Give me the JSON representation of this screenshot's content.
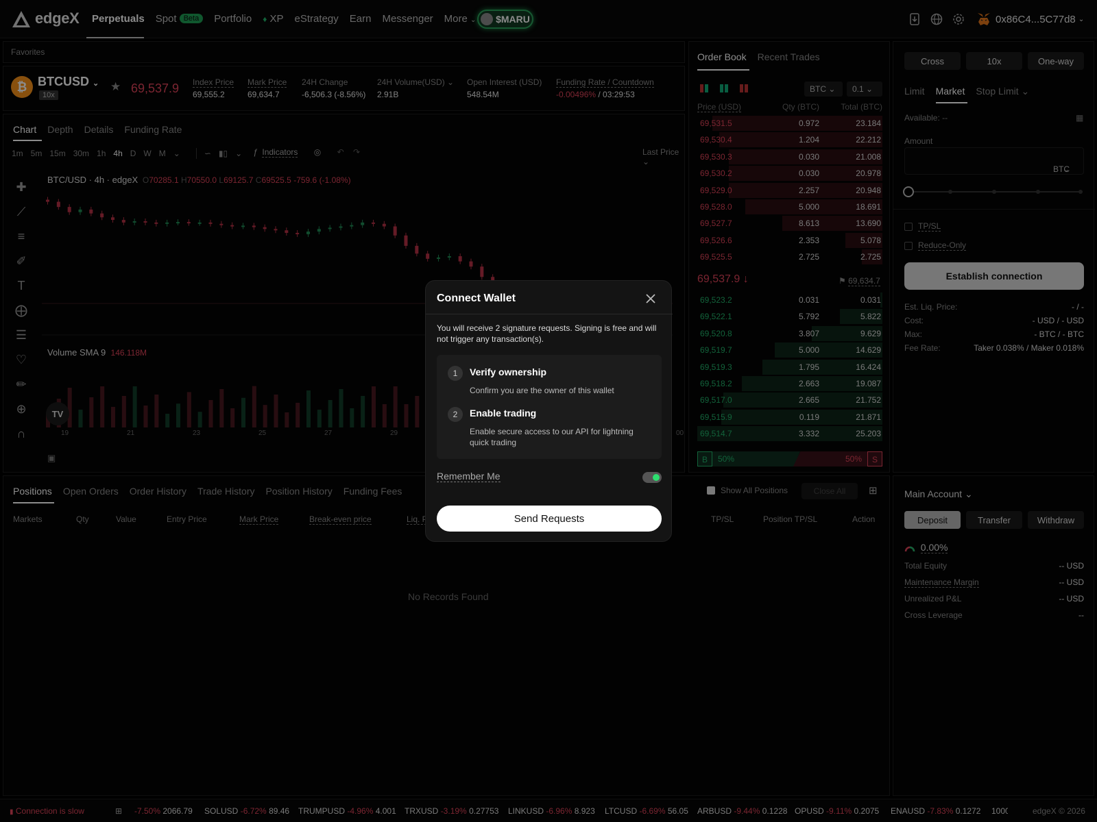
{
  "header": {
    "logo_text": "edgeX",
    "nav": [
      {
        "label": "Perpetuals",
        "active": true
      },
      {
        "label": "Spot",
        "badge": "Beta"
      },
      {
        "label": "Portfolio"
      },
      {
        "label": "XP"
      },
      {
        "label": "eStrategy"
      },
      {
        "label": "Earn"
      },
      {
        "label": "Messenger"
      },
      {
        "label": "More"
      }
    ],
    "promo": "$MARU",
    "account": "0x86C4...5C77d8"
  },
  "favorites_label": "Favorites",
  "ticker": {
    "symbol": "BTCUSD",
    "leverage": "10x",
    "last_price": "69,537.9",
    "stats": [
      {
        "label": "Index Price",
        "value": "69,555.2"
      },
      {
        "label": "Mark Price",
        "value": "69,634.7"
      },
      {
        "label": "24H Change",
        "value": "-6,506.3 (-8.56%)"
      },
      {
        "label": "24H Volume(USD)",
        "value": "2.91B"
      },
      {
        "label": "Open Interest (USD)",
        "value": "548.54M"
      },
      {
        "label": "Funding Rate / Countdown",
        "value": "-0.00496%",
        "value2": "/ 03:29:53"
      }
    ]
  },
  "chart": {
    "tabs": [
      "Chart",
      "Depth",
      "Details",
      "Funding Rate"
    ],
    "timeframes": [
      "1m",
      "5m",
      "15m",
      "30m",
      "1h",
      "4h",
      "D",
      "W",
      "M"
    ],
    "indicators_label": "Indicators",
    "last_price_label": "Last Price",
    "legend_title": "BTC/USD · 4h · edgeX",
    "ohlc": {
      "o": "70285.1",
      "h": "70550.0",
      "l": "69125.7",
      "c": "69525.5",
      "chg": "-759.6 (-1.08%)"
    },
    "volume_label": "Volume SMA 9",
    "volume_value": "146.118M",
    "x_labels": [
      "19",
      "21",
      "23",
      "25",
      "27",
      "29",
      "00"
    ],
    "logo": "TV"
  },
  "chart_data": {
    "type": "candlestick",
    "title": "BTC/USD · 4h · edgeX",
    "x_labels": [
      "19",
      "21",
      "23",
      "25",
      "27",
      "29"
    ],
    "close": [
      70100,
      69900,
      69700,
      69800,
      69650,
      69500,
      69400,
      69300,
      69350,
      69300,
      69250,
      69300,
      69320,
      69280,
      69300,
      69250,
      69200,
      69150,
      69180,
      69120,
      69050,
      69000,
      68900,
      68850,
      68950,
      69050,
      69100,
      69150,
      69200,
      69300,
      69250,
      69150,
      68800,
      68400,
      68100,
      67900,
      67950,
      68000,
      67800,
      67600,
      67200,
      66900,
      66800,
      66850,
      66900,
      66950,
      66900,
      66850
    ]
  },
  "order_book": {
    "tabs": [
      "Order Book",
      "Recent Trades"
    ],
    "unit": "BTC",
    "step": "0.1",
    "columns": [
      "Price (USD)",
      "Qty (BTC)",
      "Total (BTC)"
    ],
    "asks": [
      {
        "price": "69,531.5",
        "qty": "0.972",
        "total": "23.184",
        "depth": 0.92
      },
      {
        "price": "69,530.4",
        "qty": "1.204",
        "total": "22.212",
        "depth": 0.88
      },
      {
        "price": "69,530.3",
        "qty": "0.030",
        "total": "21.008",
        "depth": 0.83
      },
      {
        "price": "69,530.2",
        "qty": "0.030",
        "total": "20.978",
        "depth": 0.83
      },
      {
        "price": "69,529.0",
        "qty": "2.257",
        "total": "20.948",
        "depth": 0.83
      },
      {
        "price": "69,528.0",
        "qty": "5.000",
        "total": "18.691",
        "depth": 0.74
      },
      {
        "price": "69,527.7",
        "qty": "8.613",
        "total": "13.690",
        "depth": 0.54
      },
      {
        "price": "69,526.6",
        "qty": "2.353",
        "total": "5.078",
        "depth": 0.2
      },
      {
        "price": "69,525.5",
        "qty": "2.725",
        "total": "2.725",
        "depth": 0.11
      }
    ],
    "mid_price": "69,537.9",
    "mark_price": "69,634.7",
    "bids": [
      {
        "price": "69,523.2",
        "qty": "0.031",
        "total": "0.031",
        "depth": 0.01
      },
      {
        "price": "69,522.1",
        "qty": "5.792",
        "total": "5.822",
        "depth": 0.23
      },
      {
        "price": "69,520.8",
        "qty": "3.807",
        "total": "9.629",
        "depth": 0.38
      },
      {
        "price": "69,519.7",
        "qty": "5.000",
        "total": "14.629",
        "depth": 0.58
      },
      {
        "price": "69,519.3",
        "qty": "1.795",
        "total": "16.424",
        "depth": 0.65
      },
      {
        "price": "69,518.2",
        "qty": "2.663",
        "total": "19.087",
        "depth": 0.76
      },
      {
        "price": "69,517.0",
        "qty": "2.665",
        "total": "21.752",
        "depth": 0.86
      },
      {
        "price": "69,515.9",
        "qty": "0.119",
        "total": "21.871",
        "depth": 0.87
      },
      {
        "price": "69,514.7",
        "qty": "3.332",
        "total": "25.203",
        "depth": 1.0
      }
    ],
    "buy_label": "B",
    "buy_pct": "50%",
    "sell_pct": "50%",
    "sell_label": "S"
  },
  "trade": {
    "margin_mode": "Cross",
    "leverage": "10x",
    "position_mode": "One-way",
    "order_tabs": [
      "Limit",
      "Market",
      "Stop Limit"
    ],
    "available": "Available: --",
    "amount_label": "Amount",
    "amount_unit": "BTC",
    "tpsl": "TP/SL",
    "reduce_only": "Reduce-Only",
    "connect": "Establish connection",
    "info": [
      {
        "k": "Est. Liq. Price:",
        "v": "- / -"
      },
      {
        "k": "Cost:",
        "v": "- USD / - USD"
      },
      {
        "k": "Max:",
        "v": "- BTC / - BTC"
      },
      {
        "k": "Fee Rate:",
        "v": "Taker 0.038% / Maker 0.018%"
      }
    ]
  },
  "positions": {
    "tabs": [
      "Positions",
      "Open Orders",
      "Order History",
      "Trade History",
      "Position History",
      "Funding Fees"
    ],
    "show_all": "Show All Positions",
    "close_all": "Close All",
    "columns": [
      "Markets",
      "Qty",
      "Value",
      "Entry Price",
      "Mark Price",
      "Break-even price",
      "Liq. Price",
      "TP/SL",
      "Position TP/SL",
      "Action"
    ],
    "empty": "No Records Found"
  },
  "account_panel": {
    "title": "Main Account",
    "buttons": [
      "Deposit",
      "Transfer",
      "Withdraw"
    ],
    "percent": "0.00%",
    "rows": [
      {
        "k": "Total Equity",
        "v": "-- USD"
      },
      {
        "k": "Maintenance Margin",
        "v": "-- USD"
      },
      {
        "k": "Unrealized P&L",
        "v": "-- USD"
      },
      {
        "k": "Cross Leverage",
        "v": "--"
      }
    ]
  },
  "status_bar": {
    "connection": "Connection is slow",
    "tickers": [
      {
        "sym": "",
        "chg": "-7.50%",
        "px": "2066.79"
      },
      {
        "sym": "SOLUSD",
        "chg": "-6.72%",
        "px": "89.46"
      },
      {
        "sym": "TRUMPUSD",
        "chg": "-4.96%",
        "px": "4.001"
      },
      {
        "sym": "TRXUSD",
        "chg": "-3.19%",
        "px": "0.27753"
      },
      {
        "sym": "LINKUSD",
        "chg": "-6.96%",
        "px": "8.923"
      },
      {
        "sym": "LTCUSD",
        "chg": "-6.69%",
        "px": "56.05"
      },
      {
        "sym": "ARBUSD",
        "chg": "-9.44%",
        "px": "0.1228"
      },
      {
        "sym": "OPUSD",
        "chg": "-9.11%",
        "px": "0.2075"
      },
      {
        "sym": "ENAUSD",
        "chg": "-7.83%",
        "px": "0.1272"
      },
      {
        "sym": "1000!",
        "chg": "",
        "px": ""
      }
    ],
    "copyright": "edgeX © 2026"
  },
  "modal": {
    "title": "Connect Wallet",
    "description": "You will receive 2 signature requests. Signing is free and will not trigger any transaction(s).",
    "steps": [
      {
        "n": "1",
        "title": "Verify ownership",
        "desc": "Confirm you are the owner of this wallet"
      },
      {
        "n": "2",
        "title": "Enable trading",
        "desc": "Enable secure access to our API for lightning quick trading"
      }
    ],
    "remember": "Remember Me",
    "remember_on": true,
    "send": "Send Requests"
  },
  "colors": {
    "up": "#21b36a",
    "down": "#e0445a",
    "accent": "#2aa05a"
  }
}
